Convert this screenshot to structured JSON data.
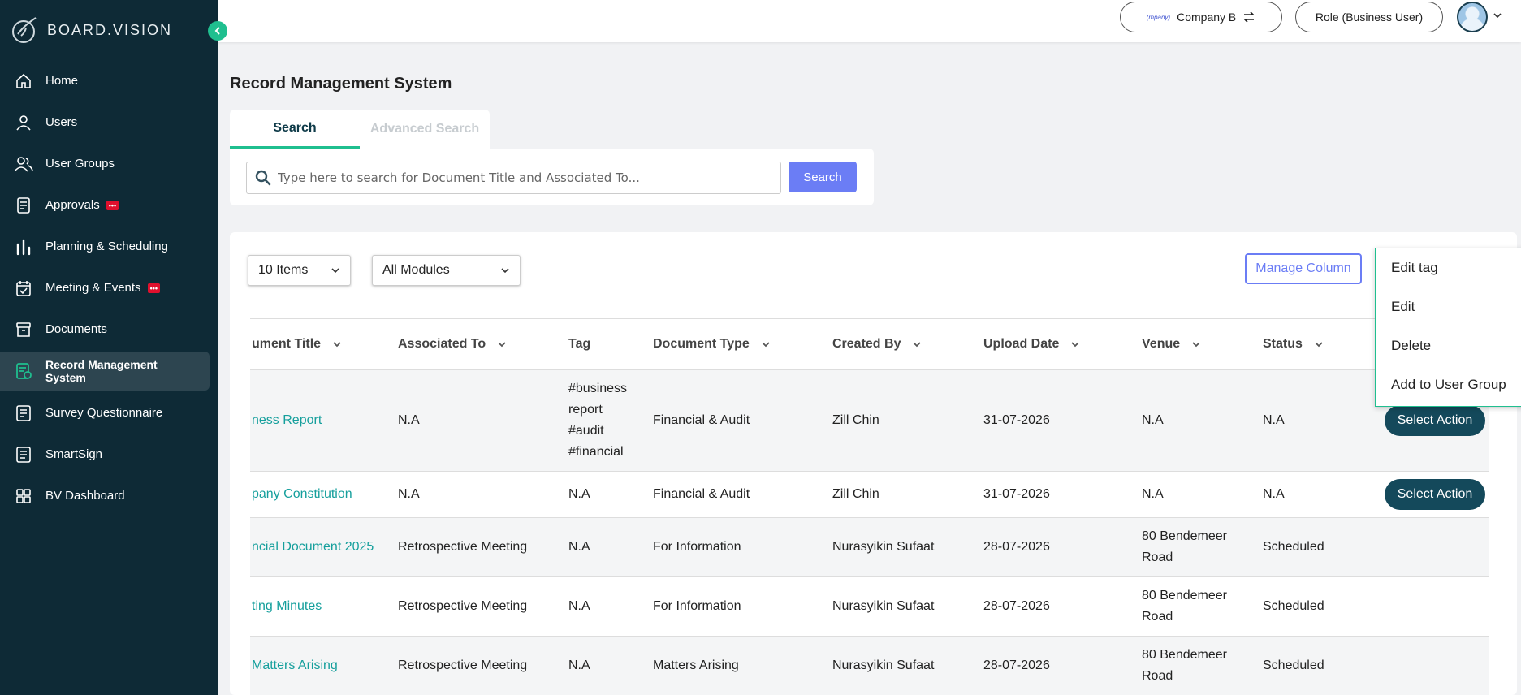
{
  "brand": {
    "name": "BOARD.VISION"
  },
  "sidebar": {
    "items": [
      {
        "label": "Home",
        "icon": "home-icon"
      },
      {
        "label": "Users",
        "icon": "user-icon"
      },
      {
        "label": "User Groups",
        "icon": "users-icon"
      },
      {
        "label": "Approvals",
        "icon": "document-icon",
        "badge": "•••"
      },
      {
        "label": "Planning & Scheduling",
        "icon": "bar-chart-icon"
      },
      {
        "label": "Meeting & Events",
        "icon": "calendar-icon",
        "badge": "•••"
      },
      {
        "label": "Documents",
        "icon": "archive-icon"
      },
      {
        "label": "Record Management System",
        "icon": "record-icon",
        "active": true
      },
      {
        "label": "Survey Questionnaire",
        "icon": "survey-icon"
      },
      {
        "label": "SmartSign",
        "icon": "sign-icon"
      },
      {
        "label": "BV Dashboard",
        "icon": "grid-icon"
      }
    ]
  },
  "topbar": {
    "company_mini": "(mpany)",
    "company_label": "Company B",
    "role_label": "Role (Business User)"
  },
  "page": {
    "title": "Record Management System",
    "tabs": [
      "Search",
      "Advanced Search"
    ]
  },
  "search": {
    "placeholder": "Type here to search for Document Title and Associated To...",
    "button_label": "Search"
  },
  "filters": {
    "items_value": "10 Items",
    "modules_value": "All Modules",
    "manage_column_label": "Manage Column"
  },
  "table": {
    "columns": [
      "ument Title",
      "Associated To",
      "Tag",
      "Document Type",
      "Created By",
      "Upload Date",
      "Venue",
      "Status"
    ],
    "rows": [
      {
        "title": "ness Report",
        "associated": "N.A",
        "tag": "#business report #audit #financial",
        "type": "Financial & Audit",
        "created_by": "Zill Chin",
        "date": "31-07-2026",
        "venue": "N.A",
        "status": "N.A",
        "action": "Select Action"
      },
      {
        "title": "pany Constitution",
        "associated": "N.A",
        "tag": "N.A",
        "type": "Financial & Audit",
        "created_by": "Zill Chin",
        "date": "31-07-2026",
        "venue": "N.A",
        "status": "N.A",
        "action": "Select Action"
      },
      {
        "title": "ncial Document 2025",
        "associated": "Retrospective Meeting",
        "tag": "N.A",
        "type": "For Information",
        "created_by": "Nurasyikin Sufaat",
        "date": "28-07-2026",
        "venue": "80 Bendemeer Road",
        "status": "Scheduled"
      },
      {
        "title": "ting Minutes",
        "associated": "Retrospective Meeting",
        "tag": "N.A",
        "type": "For Information",
        "created_by": "Nurasyikin Sufaat",
        "date": "28-07-2026",
        "venue": "80 Bendemeer Road",
        "status": "Scheduled"
      },
      {
        "title": "Matters Arising",
        "associated": "Retrospective Meeting",
        "tag": "N.A",
        "type": "Matters Arising",
        "created_by": "Nurasyikin Sufaat",
        "date": "28-07-2026",
        "venue": "80 Bendemeer Road",
        "status": "Scheduled"
      }
    ]
  },
  "action_menu": {
    "items": [
      "Edit tag",
      "Edit",
      "Delete",
      "Add to User Group"
    ]
  },
  "colors": {
    "sidebar_bg": "#0e2a36",
    "accent_green": "#1fbf8f",
    "primary_blue": "#6b7df5",
    "link_teal": "#159f9c",
    "action_button": "#14495b"
  }
}
